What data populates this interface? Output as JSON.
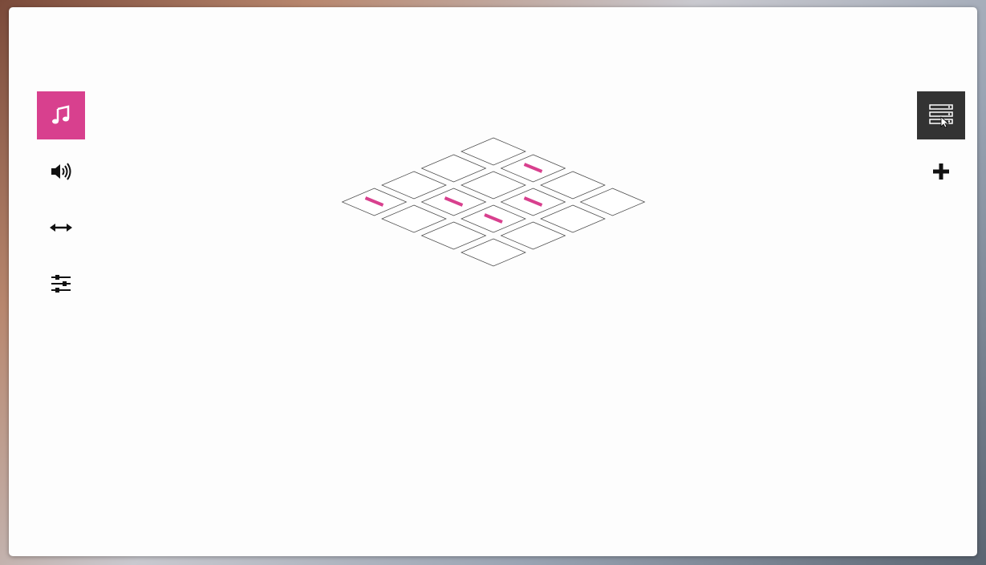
{
  "window": {
    "background": "#fdfdfd"
  },
  "left_toolbar": {
    "items": [
      {
        "id": "note",
        "icon": "music-note-icon",
        "active": true
      },
      {
        "id": "volume",
        "icon": "speaker-volume-icon",
        "active": false
      },
      {
        "id": "pitch",
        "icon": "horizontal-arrows-icon",
        "active": false
      },
      {
        "id": "settings",
        "icon": "sliders-icon",
        "active": false
      }
    ]
  },
  "right_toolbar": {
    "items": [
      {
        "id": "patterns",
        "icon": "list-rack-icon",
        "active": true
      },
      {
        "id": "add",
        "icon": "plus-icon",
        "active": false
      }
    ]
  },
  "colors": {
    "accent": "#d8408e",
    "dark": "#333333",
    "tile_stroke": "#444444"
  },
  "grid": {
    "rows": 4,
    "cols": 4,
    "active_cells": [
      [
        0,
        1
      ],
      [
        1,
        2
      ],
      [
        2,
        1
      ],
      [
        2,
        2
      ],
      [
        3,
        0
      ]
    ]
  },
  "cursor": {
    "icon": "mouse-pointer-icon"
  }
}
